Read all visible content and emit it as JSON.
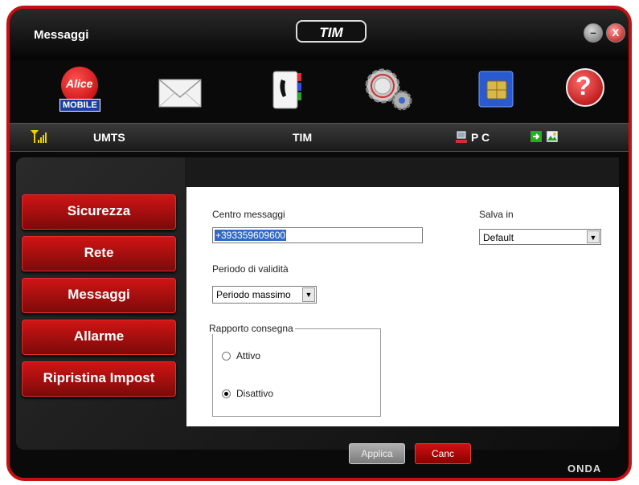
{
  "window": {
    "title": "Messaggi",
    "brand": "TIM",
    "minimize_label": "–",
    "close_label": "X"
  },
  "toolbar": {
    "alice_line1": "Alice",
    "alice_line2": "MOBILE",
    "help_label": "?"
  },
  "status": {
    "network_type": "UMTS",
    "operator": "TIM",
    "mode": "P C"
  },
  "nav": {
    "items": [
      "Sicurezza",
      "Rete",
      "Messaggi",
      "Allarme",
      "Ripristina Impost"
    ]
  },
  "form": {
    "centro_label": "Centro messaggi",
    "centro_value": "+393359609600",
    "salva_label": "Salva in",
    "salva_value": "Default",
    "periodo_label": "Periodo di validità",
    "periodo_value": "Periodo massimo",
    "rapporto_label": "Rapporto consegna",
    "attivo_label": "Attivo",
    "disattivo_label": "Disattivo",
    "selected_report": "Disattivo"
  },
  "buttons": {
    "apply": "Applica",
    "cancel": "Canc"
  },
  "footer": {
    "brand": "ONDA"
  },
  "colors": {
    "accent": "#c41010",
    "frame": "#0a0a0a",
    "panel": "#ffffff",
    "selection": "#316ac5"
  }
}
